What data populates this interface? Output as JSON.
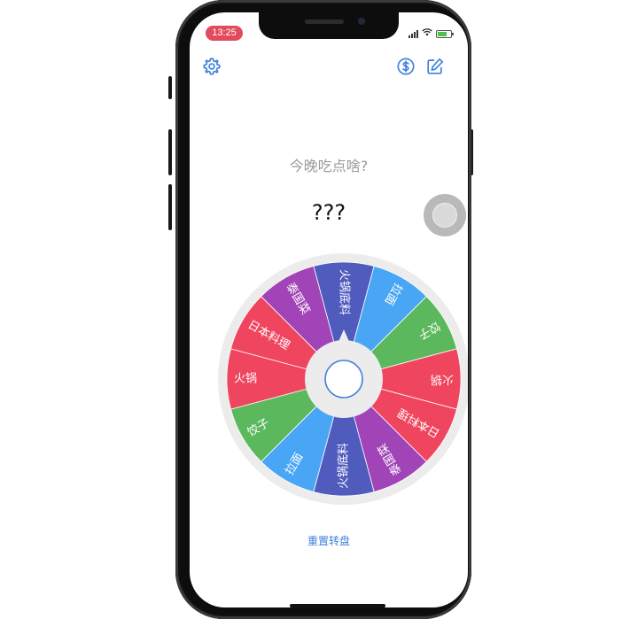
{
  "status_bar": {
    "time": "13:25"
  },
  "header": {
    "settings_icon": "gear-icon",
    "coin_icon": "dollar-icon",
    "edit_icon": "edit-icon"
  },
  "main": {
    "title": "今晚吃点啥?",
    "result": "???"
  },
  "wheel": {
    "segments": [
      {
        "label": "火锅底料",
        "color": "#4f5bbd"
      },
      {
        "label": "拉面",
        "color": "#48a6f5"
      },
      {
        "label": "饺子",
        "color": "#5cb85c"
      },
      {
        "label": "火锅",
        "color": "#f0455f"
      },
      {
        "label": "日本料理",
        "color": "#f0455f"
      },
      {
        "label": "泰国菜",
        "color": "#a144b8"
      },
      {
        "label": "火锅底料",
        "color": "#4f5bbd"
      },
      {
        "label": "拉面",
        "color": "#48a6f5"
      },
      {
        "label": "饺子",
        "color": "#5cb85c"
      },
      {
        "label": "火锅",
        "color": "#f0455f"
      },
      {
        "label": "日本料理",
        "color": "#f0455f"
      },
      {
        "label": "泰国菜",
        "color": "#a144b8"
      }
    ],
    "rim_color": "#ececec",
    "hub_color": "#3e7fdc"
  },
  "reset_label": "重置转盘"
}
